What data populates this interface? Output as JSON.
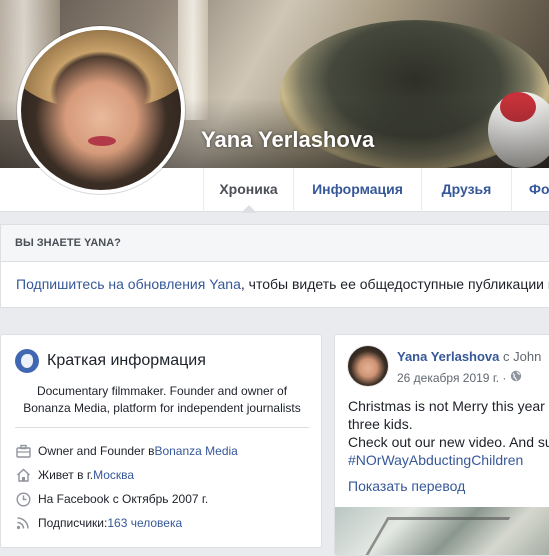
{
  "profile": {
    "name": "Yana Yerlashova"
  },
  "tabs": [
    {
      "label": "Хроника",
      "active": true
    },
    {
      "label": "Информация"
    },
    {
      "label": "Друзья"
    },
    {
      "label": "Фо"
    }
  ],
  "know_card": {
    "heading": "ВЫ ЗНАЕТЕ YANA?",
    "link_text": "Подпишитесь на обновления Yana",
    "rest_text": ", чтобы видеть ее общедоступные публикации в"
  },
  "intro": {
    "title": "Краткая информация",
    "bio": "Documentary filmmaker. Founder and owner of Bonanza Media, platform for independent journalists",
    "work": {
      "prefix": "Owner and Founder в ",
      "link": "Bonanza Media"
    },
    "lives": {
      "prefix": "Живет в г. ",
      "link": "Москва"
    },
    "joined": {
      "text": "На Facebook с Октябрь 2007 г."
    },
    "followers": {
      "prefix": "Подписчики: ",
      "link": "163 человека"
    }
  },
  "post": {
    "author": "Yana Yerlashova",
    "with_text": "с John",
    "date": "26 декабря 2019 г. ·",
    "lines": [
      "Christmas is not Merry this year",
      "three kids.",
      "Check out our new video. And su",
      "#NOrWayAbductingChildren"
    ],
    "translate_label": "Показать перевод"
  },
  "colors": {
    "link": "#365899",
    "background": "#e9ebee",
    "globe_icon": "#4267b2"
  },
  "icons": [
    "globe-icon",
    "briefcase-icon",
    "home-icon",
    "clock-icon",
    "rss-icon",
    "public-globe-icon"
  ]
}
